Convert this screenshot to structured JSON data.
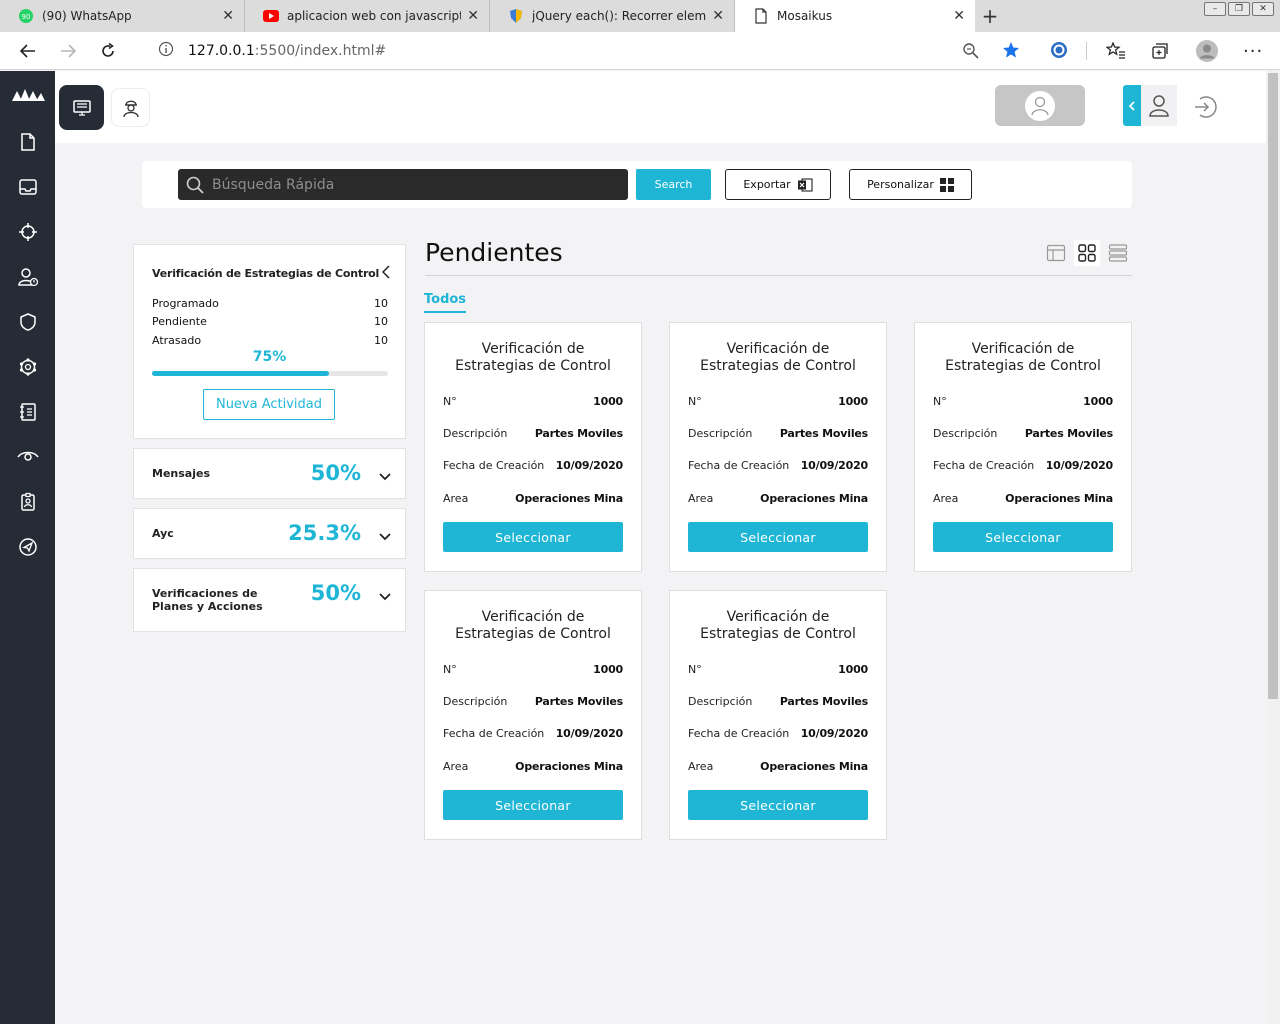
{
  "browser": {
    "tabs": [
      {
        "title": "(90) WhatsApp",
        "badge": "90",
        "icon": "whatsapp-icon"
      },
      {
        "title": "aplicacion web con javascript pur",
        "icon": "youtube-icon"
      },
      {
        "title": "jQuery each(): Recorrer elemento",
        "icon": "shield-icon"
      },
      {
        "title": "Mosaikus",
        "icon": "page-icon"
      }
    ],
    "close_glyph": "✕",
    "new_tab_glyph": "+",
    "url_host": "127.0.0.1",
    "url_path": ":5500/index.html#"
  },
  "search": {
    "placeholder": "Búsqueda Rápida",
    "button_label": "Search",
    "export_label": "Exportar",
    "customize_label": "Personalizar"
  },
  "summary": {
    "title": "Verificación de Estrategias de Control",
    "stats": [
      {
        "label": "Programado",
        "value": "10"
      },
      {
        "label": "Pendiente",
        "value": "10"
      },
      {
        "label": "Atrasado",
        "value": "10"
      }
    ],
    "progress_label": "75%",
    "progress_fraction": 0.75,
    "new_activity_label": "Nueva Actividad"
  },
  "kpis": [
    {
      "label": "Mensajes",
      "value": "50%"
    },
    {
      "label": "Ayc",
      "value": "25.3%"
    },
    {
      "label": "Verificaciones de\nPlanes y Acciones",
      "value": "50%"
    }
  ],
  "main": {
    "title": "Pendientes",
    "filter_tab": "Todos"
  },
  "card_labels": {
    "number": "N°",
    "description": "Descripción",
    "created": "Fecha de Creación",
    "area": "Area",
    "select": "Seleccionar"
  },
  "cards": [
    {
      "title": "Verificación de\nEstrategias de Control",
      "number": "1000",
      "description": "Partes Moviles",
      "created": "10/09/2020",
      "area": "Operaciones Mina"
    },
    {
      "title": "Verificación de\nEstrategias de Control",
      "number": "1000",
      "description": "Partes Moviles",
      "created": "10/09/2020",
      "area": "Operaciones Mina"
    },
    {
      "title": "Verificación de\nEstrategias de Control",
      "number": "1000",
      "description": "Partes Moviles",
      "created": "10/09/2020",
      "area": "Operaciones Mina"
    },
    {
      "title": "Verificación de\nEstrategias de Control",
      "number": "1000",
      "description": "Partes Moviles",
      "created": "10/09/2020",
      "area": "Operaciones Mina"
    },
    {
      "title": "Verificación de\nEstrategias de Control",
      "number": "1000",
      "description": "Partes Moviles",
      "created": "10/09/2020",
      "area": "Operaciones Mina"
    }
  ],
  "colors": {
    "accent": "#1fb6d6",
    "sidebar": "#252c36",
    "background": "#f3f3f5"
  }
}
